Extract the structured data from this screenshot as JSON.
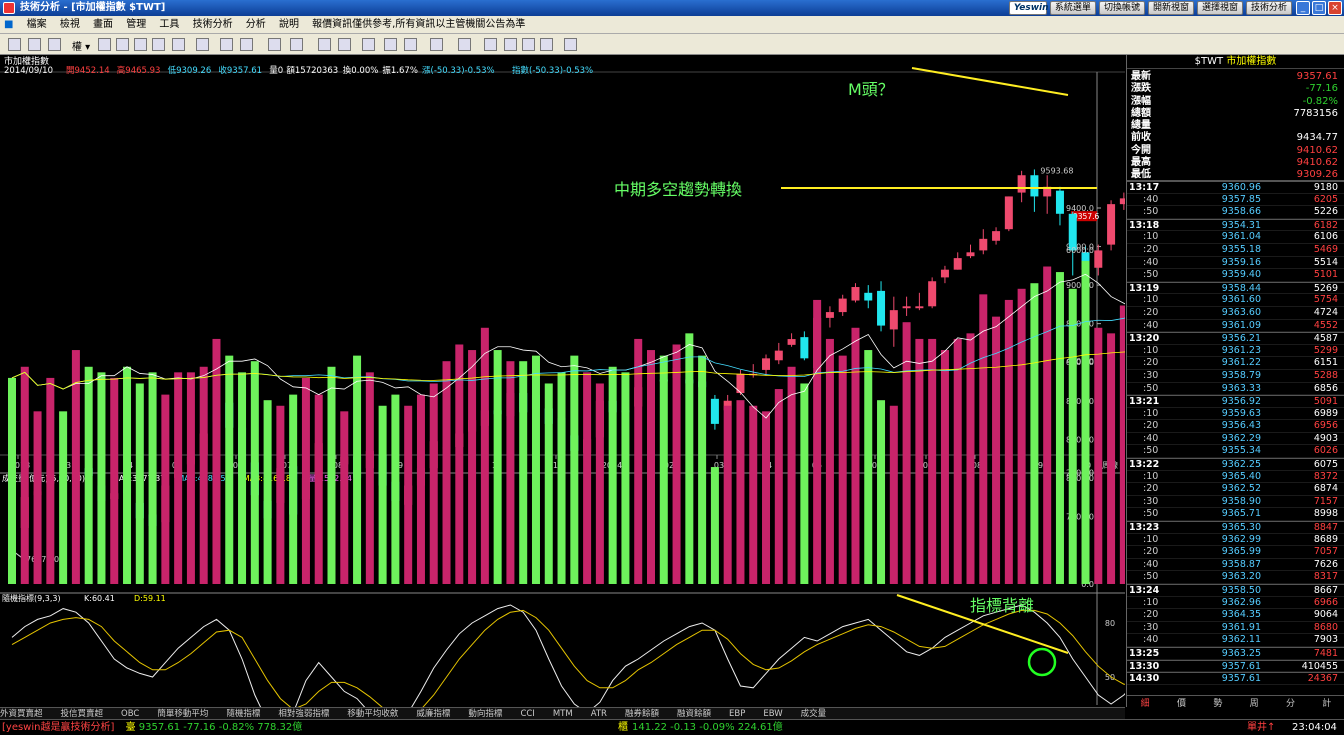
{
  "window": {
    "title": "技術分析 - [市加權指數 $TWT]",
    "brand_logo": "Yeswin",
    "buttons": [
      "系統選單",
      "切換帳號",
      "開新視窗",
      "選擇視窗",
      "技術分析"
    ]
  },
  "menu": [
    "檔案",
    "檢視",
    "畫面",
    "管理",
    "工具",
    "技術分析",
    "分析",
    "說明",
    "報價資訊僅供參考,所有資訊以主管機關公告為準"
  ],
  "toolbar": {
    "period_label": "權"
  },
  "chart": {
    "name": "市加權指數",
    "info": {
      "date": "2014/09/10",
      "open": "開9452.14",
      "high": "高9465.93",
      "low": "低9309.26",
      "close": "收9357.61",
      "vol": "量0",
      "amt": "額15720363",
      "turnover": "換0.00%",
      "amp": "振1.67%",
      "chg": "漲(-50.33)-0.53%",
      "idx": "指數(-50.33)-0.53%"
    },
    "last_price_tag": "9357.6",
    "high_mark": "9593.68",
    "low_mark": "7637.20",
    "annotations": {
      "m_top": "M頭？",
      "trend_change": "中期多空趨勢轉換",
      "divergence": "指標背離"
    },
    "x_labels": [
      "2013",
      "03",
      "04",
      "05",
      "06",
      "07",
      "08",
      "09",
      "11",
      "12",
      "2014",
      "02",
      "03",
      "04",
      "05",
      "06",
      "07",
      "08",
      "09",
      "10"
    ],
    "x_unit": "周線",
    "price_ticks": [
      "9400.0",
      "9200.0",
      "9000.0",
      "8800.0",
      "8600.0",
      "8400.0",
      "8200.0",
      "8000.0",
      "7800.0"
    ],
    "volume_title": "成交量(億元)(5,20,60)",
    "volume_ma": {
      "ma1": "MA1:3777.37",
      "ma2": "MA2:4585.52",
      "ma3": "MA3:4164.81",
      "vol": "量:1572.04"
    },
    "volume_ticks": [
      "6000.0",
      "4000.0",
      "2000.0",
      "0.0"
    ],
    "kd_title": "隨機指標(9,3,3)",
    "kd_k": "K:60.41",
    "kd_d": "D:59.11",
    "kd_ticks": [
      "80",
      "50"
    ],
    "candles": [
      [
        7690,
        7637,
        7700,
        7637
      ],
      [
        7740,
        7900,
        7940,
        7730
      ],
      [
        7910,
        7930,
        7960,
        7880
      ],
      [
        7970,
        8010,
        8040,
        7950
      ],
      [
        8010,
        7990,
        8050,
        7960
      ],
      [
        7990,
        8030,
        8070,
        7980
      ],
      [
        8050,
        8010,
        8090,
        7990
      ],
      [
        7960,
        7880,
        7990,
        7860
      ],
      [
        7890,
        7920,
        7980,
        7870
      ],
      [
        7940,
        7920,
        7970,
        7880
      ],
      [
        7870,
        7790,
        7900,
        7780
      ],
      [
        7810,
        7750,
        7850,
        7720
      ],
      [
        7770,
        7960,
        7980,
        7750
      ],
      [
        8000,
        8040,
        8070,
        7990
      ],
      [
        8070,
        8110,
        8160,
        7990
      ],
      [
        8120,
        8230,
        8270,
        8100
      ],
      [
        8290,
        8330,
        8420,
        8260
      ],
      [
        8390,
        8260,
        8440,
        8250
      ],
      [
        8260,
        8010,
        8290,
        7980
      ],
      [
        8080,
        7910,
        8080,
        7890
      ],
      [
        7880,
        7790,
        7950,
        7770
      ],
      [
        7870,
        8050,
        8070,
        7850
      ],
      [
        8060,
        7810,
        8100,
        7690
      ],
      [
        7890,
        8000,
        8020,
        7880
      ],
      [
        7990,
        8180,
        8200,
        7970
      ],
      [
        8180,
        8030,
        8240,
        8010
      ],
      [
        8070,
        8110,
        8150,
        8050
      ],
      [
        8110,
        8000,
        8140,
        7950
      ],
      [
        8050,
        8140,
        8170,
        7970
      ],
      [
        8120,
        7960,
        8180,
        7910
      ],
      [
        7980,
        7880,
        8010,
        7830
      ],
      [
        7860,
        7960,
        8010,
        7830
      ],
      [
        7960,
        8050,
        8090,
        7940
      ],
      [
        8050,
        8190,
        8230,
        8030
      ],
      [
        8150,
        8160,
        8200,
        8130
      ],
      [
        8160,
        8230,
        8260,
        8150
      ],
      [
        8240,
        8300,
        8330,
        8190
      ],
      [
        8270,
        8350,
        8370,
        8260
      ],
      [
        8350,
        8330,
        8360,
        8280
      ],
      [
        8320,
        8440,
        8460,
        8310
      ],
      [
        8440,
        8340,
        8460,
        8330
      ],
      [
        8430,
        8360,
        8450,
        8340
      ],
      [
        8360,
        8280,
        8370,
        8260
      ],
      [
        8310,
        8140,
        8320,
        8120
      ],
      [
        8220,
        8140,
        8240,
        8100
      ],
      [
        8130,
        8200,
        8250,
        8110
      ],
      [
        8210,
        8400,
        8420,
        8190
      ],
      [
        8400,
        8340,
        8420,
        8310
      ],
      [
        8350,
        8340,
        8390,
        8330
      ],
      [
        8370,
        8470,
        8500,
        8360
      ],
      [
        8460,
        8510,
        8540,
        8450
      ],
      [
        8510,
        8500,
        8580,
        8490
      ],
      [
        8520,
        8570,
        8640,
        8500
      ],
      [
        8510,
        8490,
        8610,
        8470
      ],
      [
        8500,
        8470,
        8520,
        8450
      ],
      [
        8410,
        8280,
        8430,
        8250
      ],
      [
        8350,
        8400,
        8430,
        8310
      ],
      [
        8440,
        8540,
        8560,
        8430
      ],
      [
        8540,
        8540,
        8590,
        8520
      ],
      [
        8560,
        8620,
        8640,
        8530
      ],
      [
        8610,
        8660,
        8700,
        8590
      ],
      [
        8690,
        8720,
        8750,
        8680
      ],
      [
        8730,
        8620,
        8760,
        8610
      ],
      [
        8570,
        8830,
        8840,
        8520
      ],
      [
        8830,
        8860,
        8890,
        8780
      ],
      [
        8860,
        8930,
        8950,
        8840
      ],
      [
        8920,
        8990,
        9010,
        8910
      ],
      [
        8960,
        8920,
        9000,
        8880
      ],
      [
        8970,
        8790,
        9020,
        8760
      ],
      [
        8770,
        8870,
        8940,
        8680
      ],
      [
        8880,
        8890,
        8940,
        8840
      ],
      [
        8880,
        8890,
        8960,
        8870
      ],
      [
        8890,
        9020,
        9040,
        8880
      ],
      [
        9040,
        9080,
        9100,
        9010
      ],
      [
        9080,
        9140,
        9170,
        9080
      ],
      [
        9150,
        9170,
        9210,
        9140
      ],
      [
        9180,
        9240,
        9290,
        9160
      ],
      [
        9230,
        9280,
        9300,
        9210
      ],
      [
        9290,
        9460,
        9460,
        9280
      ],
      [
        9480,
        9570,
        9593,
        9430
      ],
      [
        9570,
        9460,
        9600,
        9380
      ],
      [
        9460,
        9510,
        9570,
        9370
      ],
      [
        9490,
        9370,
        9510,
        9310
      ],
      [
        9370,
        9180,
        9380,
        9050
      ],
      [
        9170,
        9080,
        9200,
        9010
      ],
      [
        9090,
        9180,
        9210,
        9050
      ],
      [
        9210,
        9420,
        9440,
        9180
      ],
      [
        9420,
        9450,
        9480,
        9390
      ],
      [
        9450,
        9400,
        9520,
        9370
      ],
      [
        9410,
        9310,
        9470,
        9290
      ]
    ],
    "volumes": [
      3700,
      3900,
      3100,
      3700,
      3100,
      4200,
      3900,
      3800,
      3700,
      3900,
      3600,
      3800,
      3400,
      3800,
      3800,
      3900,
      4400,
      4100,
      3800,
      4000,
      3300,
      3200,
      3400,
      3700,
      3400,
      3900,
      3100,
      4100,
      3800,
      3200,
      3400,
      3200,
      3400,
      3600,
      4000,
      4300,
      4200,
      4600,
      4200,
      4000,
      4000,
      4100,
      3600,
      3800,
      4100,
      3800,
      3600,
      3900,
      3800,
      4400,
      4200,
      4100,
      4300,
      4500,
      4100,
      2100,
      3200,
      3300,
      3200,
      3100,
      3500,
      3900,
      3600,
      5100,
      4400,
      4100,
      4600,
      4200,
      3300,
      3200,
      4700,
      4400,
      4400,
      4200,
      4400,
      4500,
      5200,
      4800,
      5100,
      5300,
      5400,
      5700,
      5600,
      5300,
      5800,
      4600,
      4500,
      5000,
      4700,
      1600
    ],
    "k_values": [
      72,
      78,
      82,
      84,
      88,
      86,
      80,
      70,
      60,
      55,
      52,
      50,
      58,
      66,
      72,
      78,
      82,
      76,
      60,
      40,
      25,
      20,
      30,
      48,
      58,
      50,
      42,
      38,
      30,
      24,
      22,
      30,
      42,
      55,
      65,
      74,
      80,
      84,
      88,
      90,
      86,
      76,
      60,
      45,
      35,
      30,
      36,
      48,
      56,
      60,
      65,
      70,
      74,
      78,
      80,
      76,
      60,
      45,
      44,
      52,
      60,
      66,
      72,
      70,
      74,
      78,
      80,
      82,
      76,
      70,
      64,
      62,
      66,
      72,
      76,
      80,
      84,
      86,
      88,
      90,
      86,
      80,
      72,
      60,
      50,
      40,
      35,
      40,
      48,
      55
    ],
    "d_values": [
      68,
      72,
      76,
      80,
      82,
      83,
      82,
      78,
      70,
      64,
      58,
      54,
      54,
      58,
      63,
      69,
      75,
      76,
      72,
      60,
      48,
      38,
      32,
      35,
      42,
      47,
      47,
      44,
      39,
      33,
      28,
      27,
      32,
      40,
      50,
      60,
      68,
      76,
      82,
      86,
      87,
      83,
      76,
      66,
      56,
      48,
      44,
      44,
      48,
      54,
      58,
      63,
      68,
      72,
      76,
      76,
      71,
      63,
      57,
      54,
      55,
      59,
      64,
      68,
      71,
      74,
      77,
      79,
      78,
      75,
      71,
      67,
      66,
      67,
      71,
      75,
      79,
      82,
      85,
      87,
      87,
      85,
      80,
      73,
      64,
      56,
      50,
      46,
      46,
      49
    ]
  },
  "quote": {
    "symbol": "$TWT",
    "name": "市加權指數",
    "rows": [
      {
        "k": "最新",
        "v": "9357.61",
        "c": "#ff4040"
      },
      {
        "k": "漲跌",
        "v": "-77.16",
        "c": "#2fd12f"
      },
      {
        "k": "漲幅",
        "v": "-0.82%",
        "c": "#2fd12f"
      },
      {
        "k": "總額",
        "v": "7783156",
        "c": "#ffffff"
      },
      {
        "k": "總量",
        "v": "",
        "c": "#ffffff"
      },
      {
        "k": "前收",
        "v": "9434.77",
        "c": "#ffffff"
      },
      {
        "k": "今開",
        "v": "9410.62",
        "c": "#ff4040"
      },
      {
        "k": "最高",
        "v": "9410.62",
        "c": "#ff4040"
      },
      {
        "k": "最低",
        "v": "9309.26",
        "c": "#ff4040"
      }
    ],
    "ticks": [
      [
        "13:17",
        "9360.96",
        "9180"
      ],
      [
        ":40",
        "9357.85",
        "6205"
      ],
      [
        ":50",
        "9358.66",
        "5226"
      ],
      [
        "13:18",
        "9354.31",
        "6182"
      ],
      [
        ":10",
        "9361.04",
        "6106"
      ],
      [
        ":20",
        "9355.18",
        "5469"
      ],
      [
        ":40",
        "9359.16",
        "5514"
      ],
      [
        ":50",
        "9359.40",
        "5101"
      ],
      [
        "13:19",
        "9358.44",
        "5269"
      ],
      [
        ":10",
        "9361.60",
        "5754"
      ],
      [
        ":20",
        "9363.60",
        "4724"
      ],
      [
        ":40",
        "9361.09",
        "4552"
      ],
      [
        "13:20",
        "9356.21",
        "4587"
      ],
      [
        ":10",
        "9361.23",
        "5299"
      ],
      [
        ":20",
        "9361.22",
        "6151"
      ],
      [
        ":30",
        "9358.79",
        "5288"
      ],
      [
        ":50",
        "9363.33",
        "6856"
      ],
      [
        "13:21",
        "9356.92",
        "5091"
      ],
      [
        ":10",
        "9359.63",
        "6989"
      ],
      [
        ":20",
        "9356.43",
        "6956"
      ],
      [
        ":40",
        "9362.29",
        "4903"
      ],
      [
        ":50",
        "9355.34",
        "6026"
      ],
      [
        "13:22",
        "9362.25",
        "6075"
      ],
      [
        ":10",
        "9365.40",
        "8372"
      ],
      [
        ":20",
        "9362.52",
        "6874"
      ],
      [
        ":30",
        "9358.90",
        "7157"
      ],
      [
        ":50",
        "9365.71",
        "8998"
      ],
      [
        "13:23",
        "9365.30",
        "8847"
      ],
      [
        ":10",
        "9362.99",
        "8689"
      ],
      [
        ":20",
        "9365.99",
        "7057"
      ],
      [
        ":40",
        "9358.87",
        "7626"
      ],
      [
        ":50",
        "9363.20",
        "8317"
      ],
      [
        "13:24",
        "9358.50",
        "8667"
      ],
      [
        ":10",
        "9362.96",
        "6966"
      ],
      [
        ":20",
        "9364.35",
        "9064"
      ],
      [
        ":30",
        "9361.91",
        "8680"
      ],
      [
        ":40",
        "9362.11",
        "7903"
      ],
      [
        "13:25",
        "9363.25",
        "7481"
      ],
      [
        "13:30",
        "9357.61",
        "410455"
      ],
      [
        "14:30",
        "9357.61",
        "24367"
      ]
    ],
    "tabs": [
      "細",
      "價",
      "勢",
      "周",
      "分",
      "計"
    ]
  },
  "indicators": [
    "外資買賣超",
    "投信買賣超",
    "OBC",
    "簡單移動平均",
    "隨機指標",
    "相對強弱指標",
    "移動平均收斂",
    "威廉指標",
    "動向指標",
    "CCI",
    "MTM",
    "ATR",
    "融券餘額",
    "融資餘額",
    "EBP",
    "EBW",
    "成交量"
  ],
  "status": {
    "brand": "[yeswin越是贏技術分析]",
    "s1_label": "臺",
    "s1": "9357.61 -77.16 -0.82% 778.32億",
    "s2_label": "櫃",
    "s2": "141.22 -0.13 -0.09% 224.61億",
    "tail": "單井↑",
    "clock": "23:04:04"
  }
}
